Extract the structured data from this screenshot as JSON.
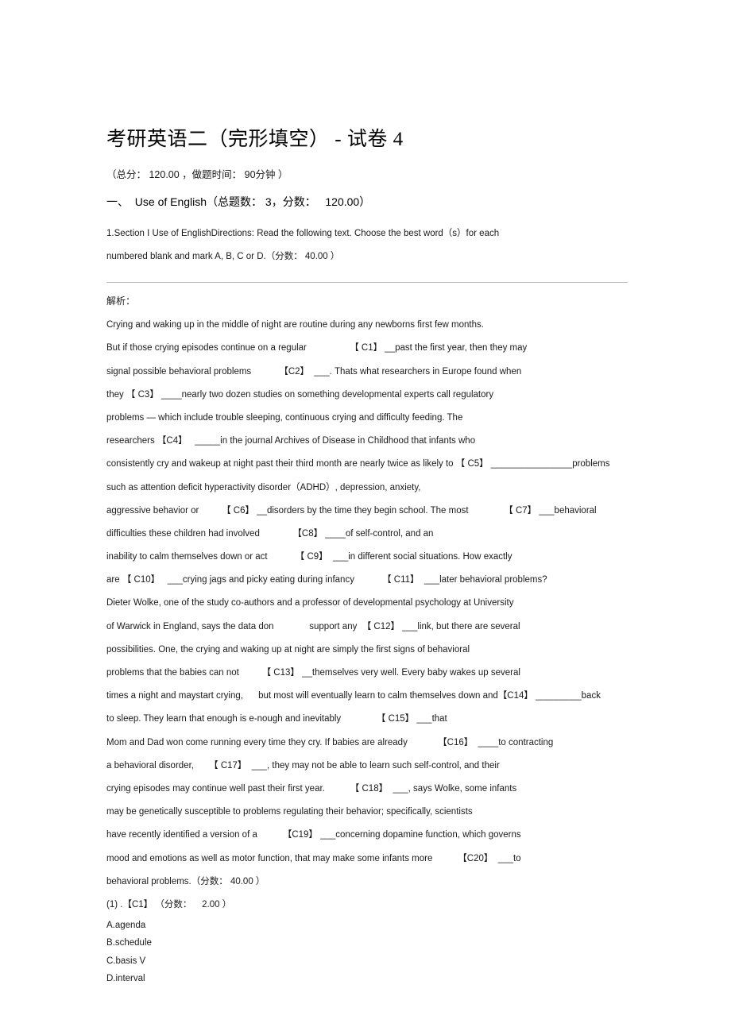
{
  "document": {
    "title": "考研英语二（完形填空） - 试卷 4",
    "meta_line": "（总分： 120.00 ，做题时间： 90分钟 ）",
    "section_heading": "一、  Use of English（总题数： 3，分数：   120.00）",
    "directions": {
      "line1": "1.Section I Use of EnglishDirections: Read the following text. Choose the best word（s）for each",
      "line2": "numbered blank and mark A, B, C or D.（分数： 40.00 ）"
    },
    "analysis_label": "解析：",
    "passage_lines": [
      "Crying and waking up in the middle of night are routine during any newborns first few months.",
      "But if those crying episodes continue on a regular                 【 C1】 __past the first year, then they may",
      "signal possible behavioral problems           【C2】  ___. Thats what researchers in Europe found when",
      "they 【 C3】 ____nearly two dozen studies on something developmental experts call regulatory",
      "problems — which include trouble sleeping, continuous crying and difficulty feeding. The",
      "researchers 【C4】   _____in the journal Archives of Disease in Childhood that infants who",
      "consistently cry and wakeup at night past their third month are nearly twice as likely to 【 C5】 ________________problems",
      "such as attention deficit hyperactivity disorder（ADHD）, depression, anxiety,",
      "aggressive behavior or         【 C6】 __disorders by the time they begin school. The most              【 C7】 ___behavioral",
      "difficulties these children had involved             【C8】 ____of self-control, and an",
      "inability to calm themselves down or act           【 C9】  ___in different social situations. How exactly",
      "are 【 C10】   ___crying jags and picky eating during infancy           【 C11】  ___later behavioral problems?",
      "Dieter Wolke, one of the study co-authors and a professor of developmental psychology at University",
      "of Warwick in England, says the data don              support any  【 C12】 ___link, but there are several",
      "possibilities. One, the crying and waking up at night are simply the first signs of behavioral",
      "problems that the babies can not         【 C13】 __themselves very well. Every baby wakes up several",
      "times a night and maystart crying,      but most will eventually learn to calm themselves down and【C14】 _________back",
      "to sleep. They learn that enough is e-nough and inevitably              【 C15】 ___that",
      "Mom and Dad won come running every time they cry. If babies are already            【C16】  ____to contracting",
      "a behavioral disorder,      【 C17】  ___, they may not be able to learn such self-control, and their",
      "crying episodes may continue well past their first year.          【 C18】  ___, says Wolke, some infants",
      "may be genetically susceptible to problems regulating their behavior; specifically, scientists",
      "have recently identified a version of a          【C19】 ___concerning dopamine function, which governs",
      "mood and emotions as well as motor function, that may make some infants more          【C20】  ___to",
      "behavioral problems.（分数： 40.00 ）"
    ],
    "question": {
      "number_line": "(1) .【C1】 （分数：    2.00 ）",
      "options": [
        "A.agenda",
        "B.schedule",
        "C.basis V",
        "D.interval"
      ]
    }
  }
}
